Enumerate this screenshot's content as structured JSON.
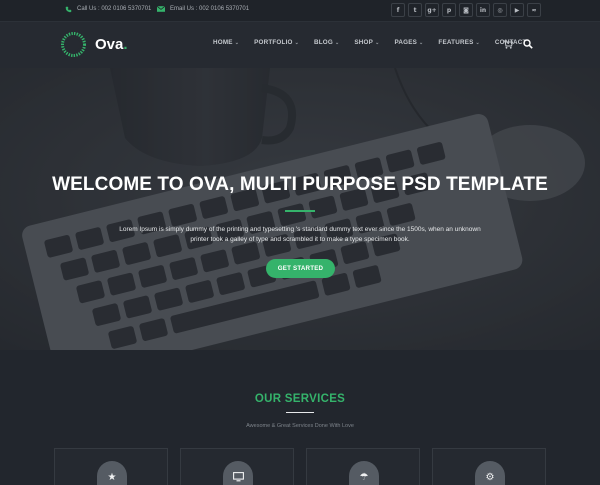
{
  "topbar": {
    "call_text": "Call Us : 002 0106 5370701",
    "email_text": "Email Us : 002 0106 5370701",
    "socials": [
      {
        "icon": "facebook-icon",
        "glyph": "f"
      },
      {
        "icon": "twitter-icon",
        "glyph": "t"
      },
      {
        "icon": "google-plus-icon",
        "glyph": "g+"
      },
      {
        "icon": "pinterest-icon",
        "glyph": "p"
      },
      {
        "icon": "instagram-icon",
        "glyph": "◙"
      },
      {
        "icon": "linkedin-icon",
        "glyph": "in"
      },
      {
        "icon": "dribbble-icon",
        "glyph": "◎"
      },
      {
        "icon": "youtube-icon",
        "glyph": "▶"
      },
      {
        "icon": "rss-icon",
        "glyph": "≈"
      }
    ]
  },
  "nav": {
    "brand": "Ova",
    "brand_dot": ".",
    "menu": [
      {
        "label": "HOME",
        "dropdown": true
      },
      {
        "label": "PORTFOLIO",
        "dropdown": true
      },
      {
        "label": "BLOG",
        "dropdown": true
      },
      {
        "label": "SHOP",
        "dropdown": true
      },
      {
        "label": "PAGES",
        "dropdown": true
      },
      {
        "label": "FEATURES",
        "dropdown": true
      },
      {
        "label": "CONTACT",
        "dropdown": false
      }
    ]
  },
  "hero": {
    "title": "WELCOME TO OVA, MULTI PURPOSE PSD TEMPLATE",
    "text_line1": "Lorem Ipsum is simply dummy of the printing and typesetting 's standard dummy text ever since the 1500s, when an unknown",
    "text_line2": "printer took a galley of type and scrambled it to make a type specimen book.",
    "cta": "GET STARTED"
  },
  "services": {
    "title": "OUR SERVICES",
    "subtitle": "Awesome & Great Services Done With Love",
    "cards": [
      {
        "icon": "star-icon",
        "glyph": "★"
      },
      {
        "icon": "monitor-icon",
        "glyph": "▭"
      },
      {
        "icon": "umbrella-icon",
        "glyph": "☂"
      },
      {
        "icon": "gear-icon",
        "glyph": "⚙"
      }
    ]
  },
  "colors": {
    "accent": "#35b36b",
    "background": "#22262d",
    "navbar": "#262a31"
  }
}
